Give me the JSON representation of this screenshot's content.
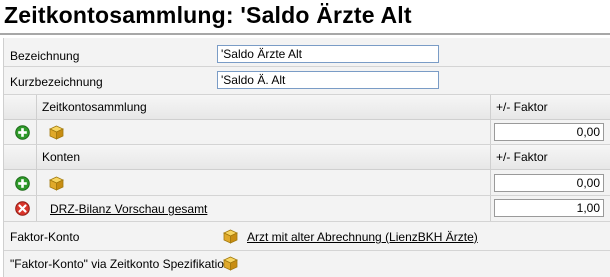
{
  "title": "Zeitkontosammlung: 'Saldo Ärzte Alt",
  "fields": {
    "bezeichnung_label": "Bezeichnung",
    "bezeichnung_value": "'Saldo Ärzte Alt",
    "kurzbezeichnung_label": "Kurzbezeichnung",
    "kurzbezeichnung_value": "'Saldo Ä. Alt"
  },
  "zeitkontosammlung_table": {
    "column_name": "Zeitkontosammlung",
    "column_factor": "+/- Faktor",
    "new_row_factor": "0,00"
  },
  "konten_table": {
    "column_name": "Konten",
    "column_factor": "+/- Faktor",
    "new_row_factor": "0,00",
    "rows": [
      {
        "name": "DRZ-Bilanz Vorschau gesamt",
        "factor": "1,00"
      }
    ]
  },
  "faktor_konto": {
    "label": "Faktor-Konto",
    "link": "Arzt mit alter Abrechnung (LienzBKH Ärzte)"
  },
  "faktor_konto_spec": {
    "label": "\"Faktor-Konto\" via Zeitkonto Spezifikation"
  },
  "icons": {
    "add": "add-green-plus-icon",
    "remove": "remove-red-x-icon",
    "box": "yellow-box-icon"
  }
}
